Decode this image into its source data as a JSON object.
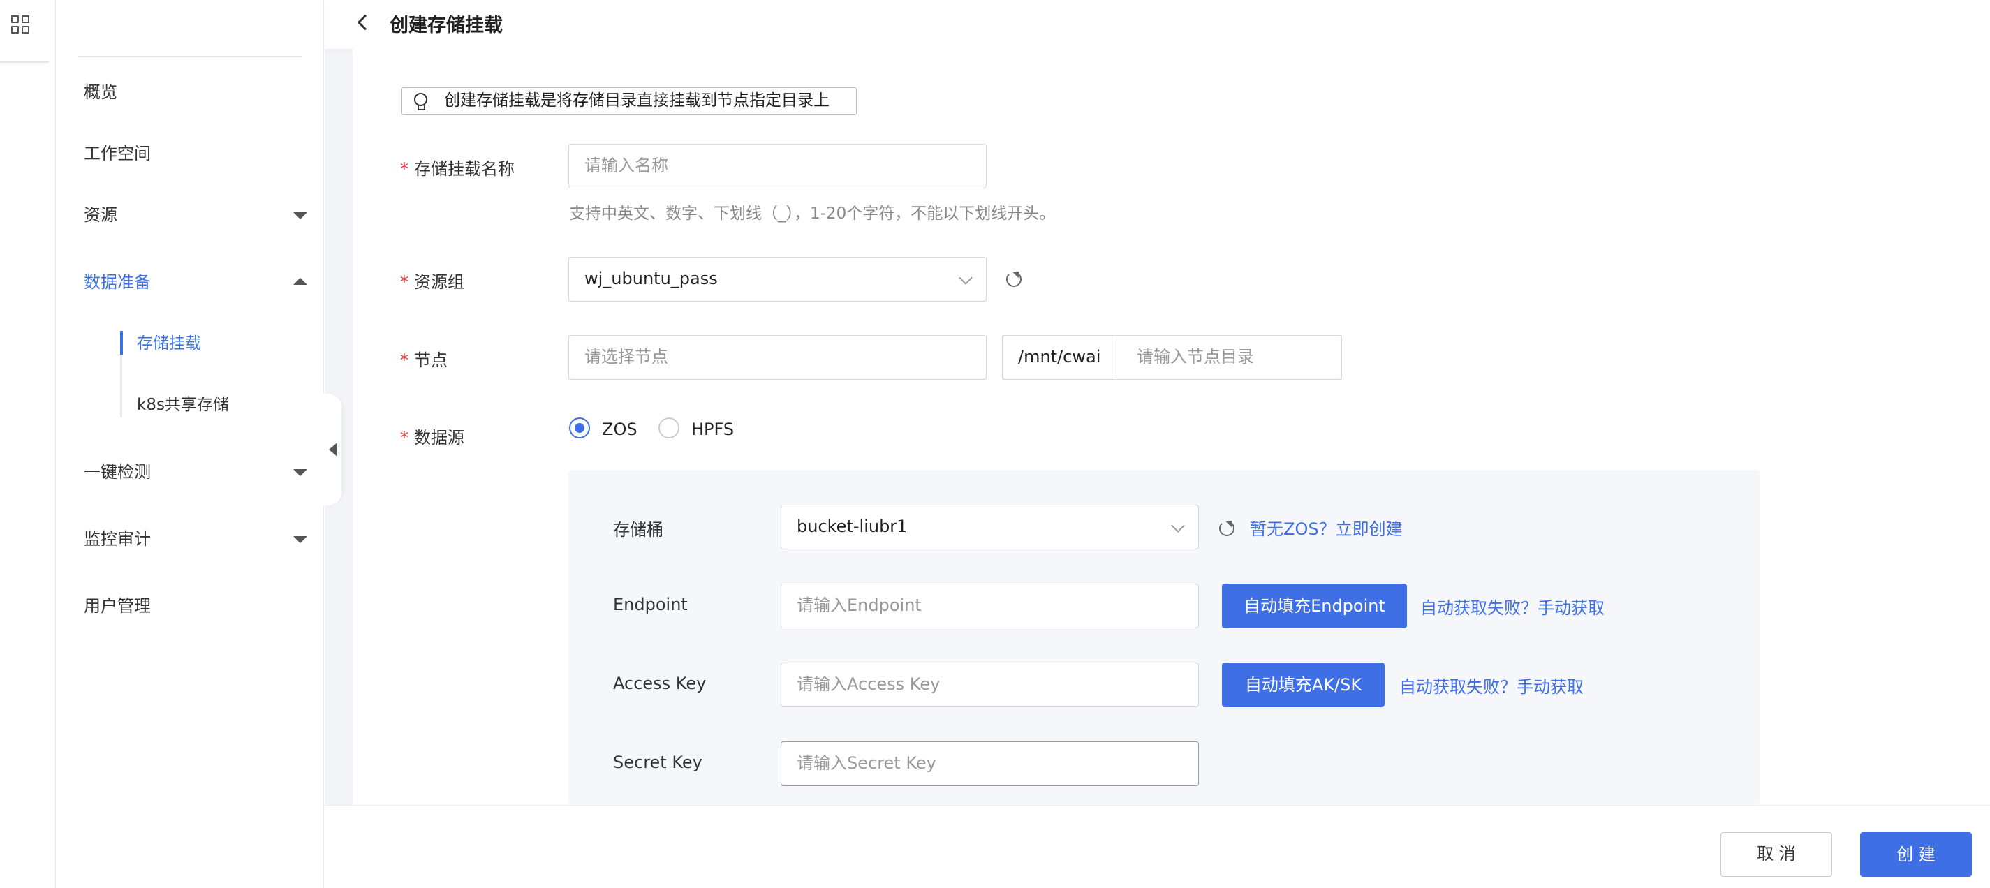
{
  "header": {
    "title": "创建存储挂载"
  },
  "sidebar": {
    "items": [
      {
        "label": "概览"
      },
      {
        "label": "工作空间"
      },
      {
        "label": "资源"
      },
      {
        "label": "数据准备"
      },
      {
        "label": "一键检测"
      },
      {
        "label": "监控审计"
      },
      {
        "label": "用户管理"
      }
    ],
    "sub_items": [
      {
        "label": "存储挂载"
      },
      {
        "label": "k8s共享存储"
      }
    ]
  },
  "tip": "创建存储挂载是将存储目录直接挂载到节点指定目录上",
  "form": {
    "name": {
      "label": "存储挂载名称",
      "placeholder": "请输入名称",
      "hint": "支持中英文、数字、下划线（_），1-20个字符，不能以下划线开头。"
    },
    "resource_group": {
      "label": "资源组",
      "value": "wj_ubuntu_pass"
    },
    "node": {
      "label": "节点",
      "placeholder": "请选择节点",
      "dir_prefix": "/mnt/cwai",
      "dir_placeholder": "请输入节点目录"
    },
    "datasource": {
      "label": "数据源",
      "options": [
        "ZOS",
        "HPFS"
      ],
      "selected": "ZOS"
    },
    "bucket": {
      "label": "存储桶",
      "value": "bucket-liubr1",
      "link": "暂无ZOS？立即创建"
    },
    "endpoint": {
      "label": "Endpoint",
      "placeholder": "请输入Endpoint",
      "button": "自动填充Endpoint",
      "link": "自动获取失败？手动获取"
    },
    "access_key": {
      "label": "Access Key",
      "placeholder": "请输入Access Key",
      "button": "自动填充AK/SK",
      "link": "自动获取失败？手动获取"
    },
    "secret_key": {
      "label": "Secret Key",
      "placeholder": "请输入Secret Key"
    }
  },
  "footer": {
    "cancel": "取 消",
    "create": "创 建"
  },
  "colors": {
    "primary": "#3e6fe4",
    "required": "#e03e3e",
    "panel": "#f5f7fa"
  }
}
